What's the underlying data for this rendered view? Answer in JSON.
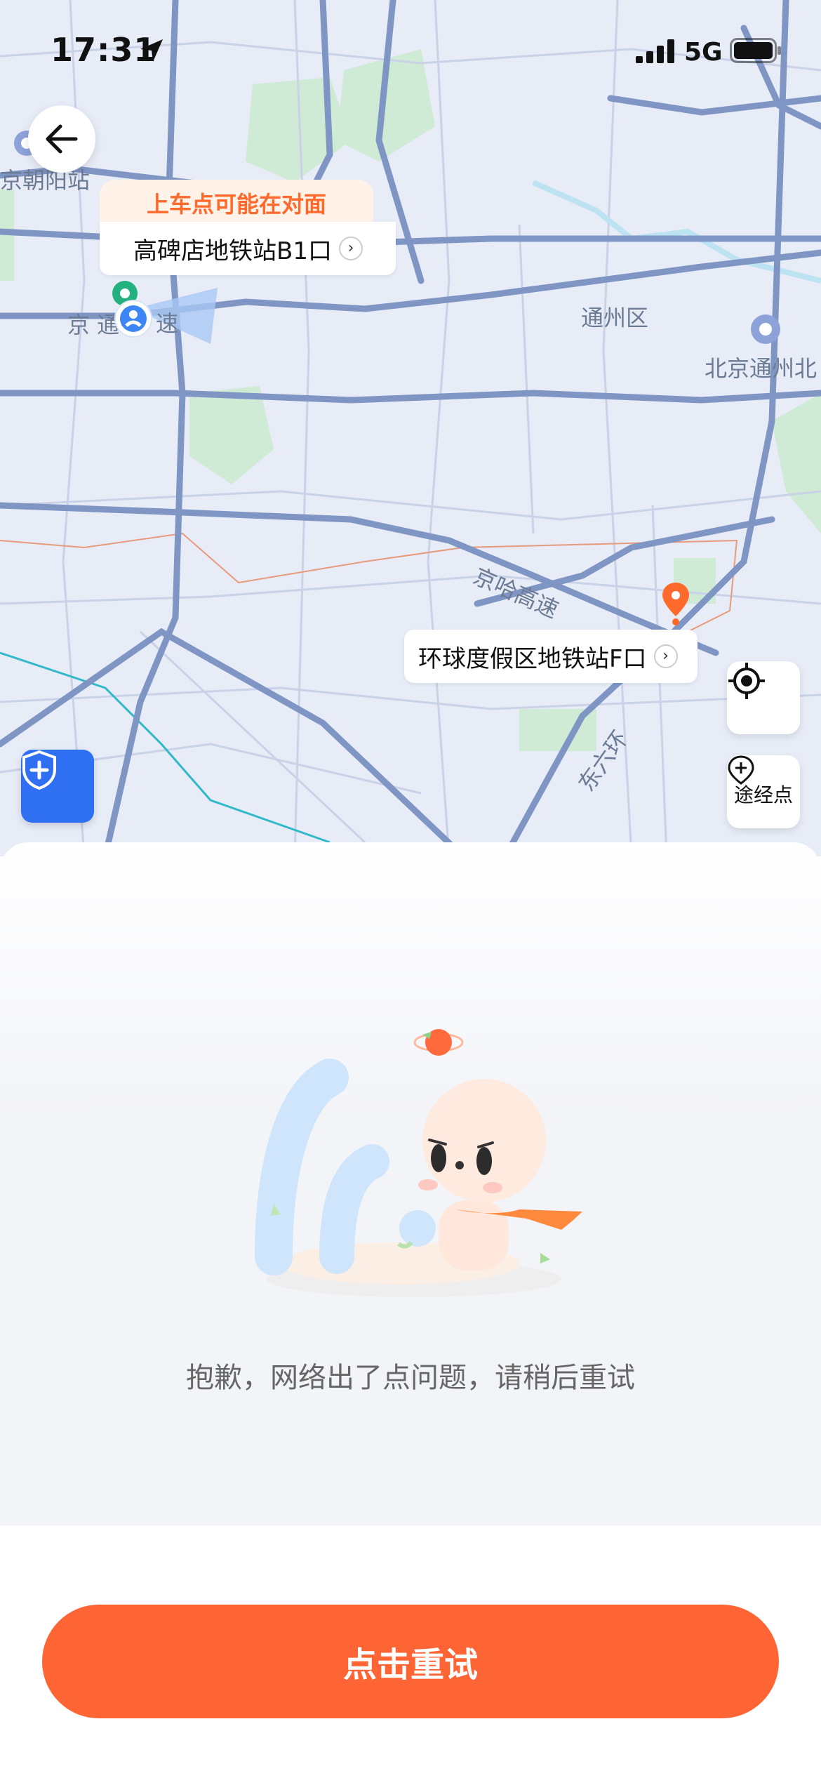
{
  "status_bar": {
    "time": "17:31",
    "network": "5G"
  },
  "map": {
    "labels": [
      "京朝阳站",
      "通州区",
      "北京通州北",
      "京哈高速",
      "东六环",
      "京 通",
      "速"
    ],
    "pickup_tip": "上车点可能在对面",
    "pickup_name": "高碑店地铁站B1口",
    "dest_name": "环球度假区地铁站F口",
    "waypoint_label": "途经点"
  },
  "error": {
    "message": "抱歉，网络出了点问题，请稍后重试"
  },
  "actions": {
    "retry_label": "点击重试"
  },
  "colors": {
    "accent": "#ff6434",
    "safety": "#2f6ff2",
    "pickup": "#22b17f",
    "dest": "#ff6a2c"
  },
  "icons": [
    "back-arrow-icon",
    "location-arrow-icon",
    "signal-icon",
    "battery-icon",
    "shield-plus-icon",
    "locate-target-icon",
    "add-waypoint-icon",
    "chevron-right-icon"
  ]
}
